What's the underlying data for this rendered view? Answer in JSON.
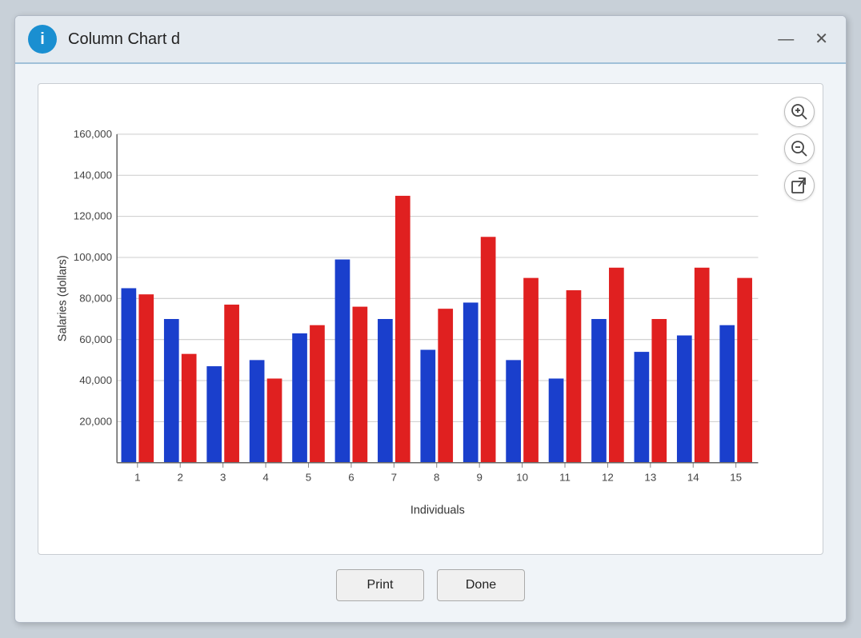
{
  "window": {
    "title": "Column Chart d",
    "title_icon": "i"
  },
  "controls": {
    "minimize": "—",
    "close": "✕"
  },
  "chart": {
    "y_axis_label": "Salaries (dollars)",
    "x_axis_label": "Individuals",
    "y_ticks": [
      "160000",
      "140000",
      "120000",
      "100000",
      "80000",
      "60000",
      "40000",
      "20000"
    ],
    "x_ticks": [
      "1",
      "2",
      "3",
      "4",
      "5",
      "6",
      "7",
      "8",
      "9",
      "10",
      "11",
      "12",
      "13",
      "14",
      "15"
    ],
    "blue_values": [
      85000,
      70000,
      47000,
      50000,
      63000,
      99000,
      70000,
      55000,
      78000,
      50000,
      41000,
      70000,
      54000,
      62000,
      67000
    ],
    "red_values": [
      82000,
      53000,
      77000,
      41000,
      67000,
      76000,
      130000,
      75000,
      110000,
      90000,
      84000,
      95000,
      70000,
      95000,
      90000
    ],
    "colors": {
      "blue": "#1a3fcc",
      "red": "#e02020"
    }
  },
  "buttons": {
    "print": "Print",
    "done": "Done"
  },
  "zoom": {
    "zoom_in": "⊕",
    "zoom_out": "⊖",
    "export": "↗"
  }
}
